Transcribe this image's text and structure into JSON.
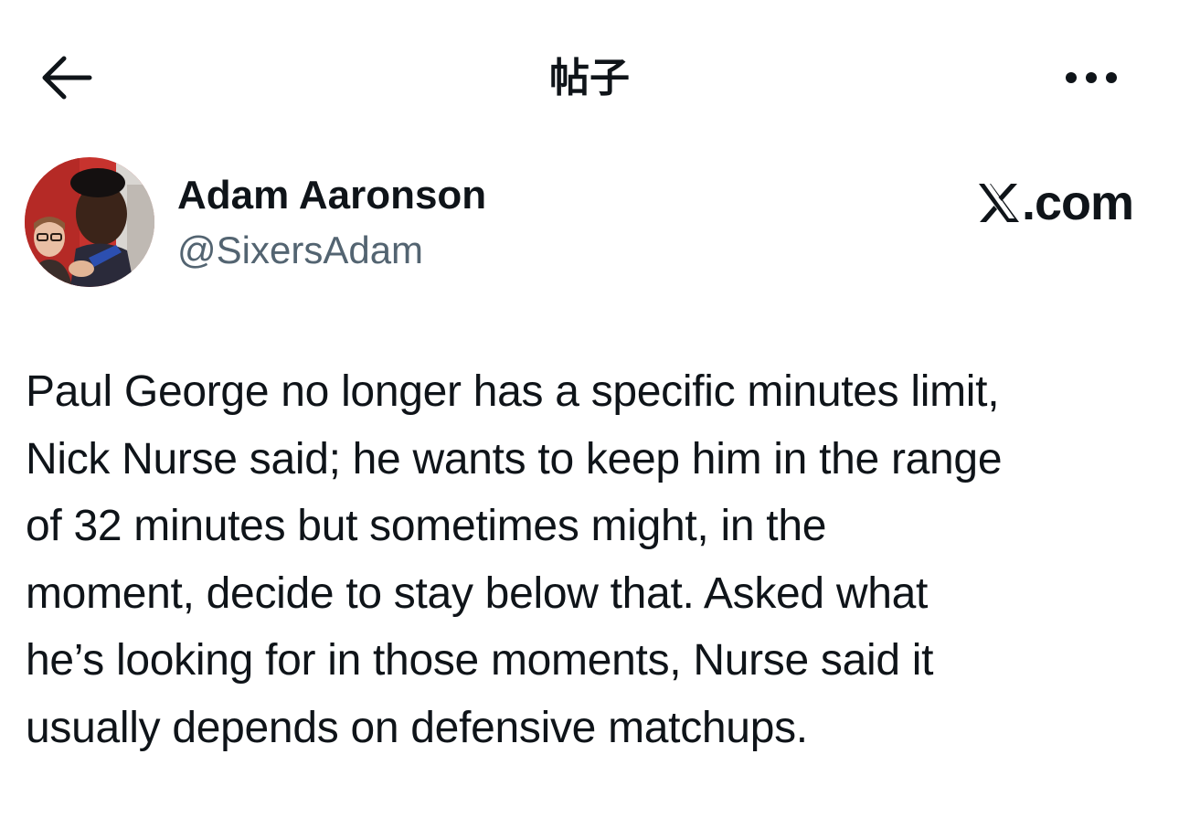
{
  "header": {
    "title": "帖子",
    "back_icon": "arrow-left-icon",
    "more_icon": "more-horizontal-icon"
  },
  "post": {
    "author": {
      "name": "Adam Aaronson",
      "handle": "@SixersAdam",
      "avatar_icon": "profile-photo"
    },
    "source_label": ".com",
    "source_icon": "x-logo-icon",
    "text": "Paul George no longer has a specific minutes limit,\nNick Nurse said; he wants to keep him in the range\nof 32 minutes but sometimes might, in the\nmoment, decide to stay below that. Asked what\nhe’s looking for in those moments, Nurse said it\nusually depends on defensive matchups."
  },
  "colors": {
    "text_primary": "#0f1419",
    "text_secondary": "#536471",
    "background": "#ffffff"
  }
}
